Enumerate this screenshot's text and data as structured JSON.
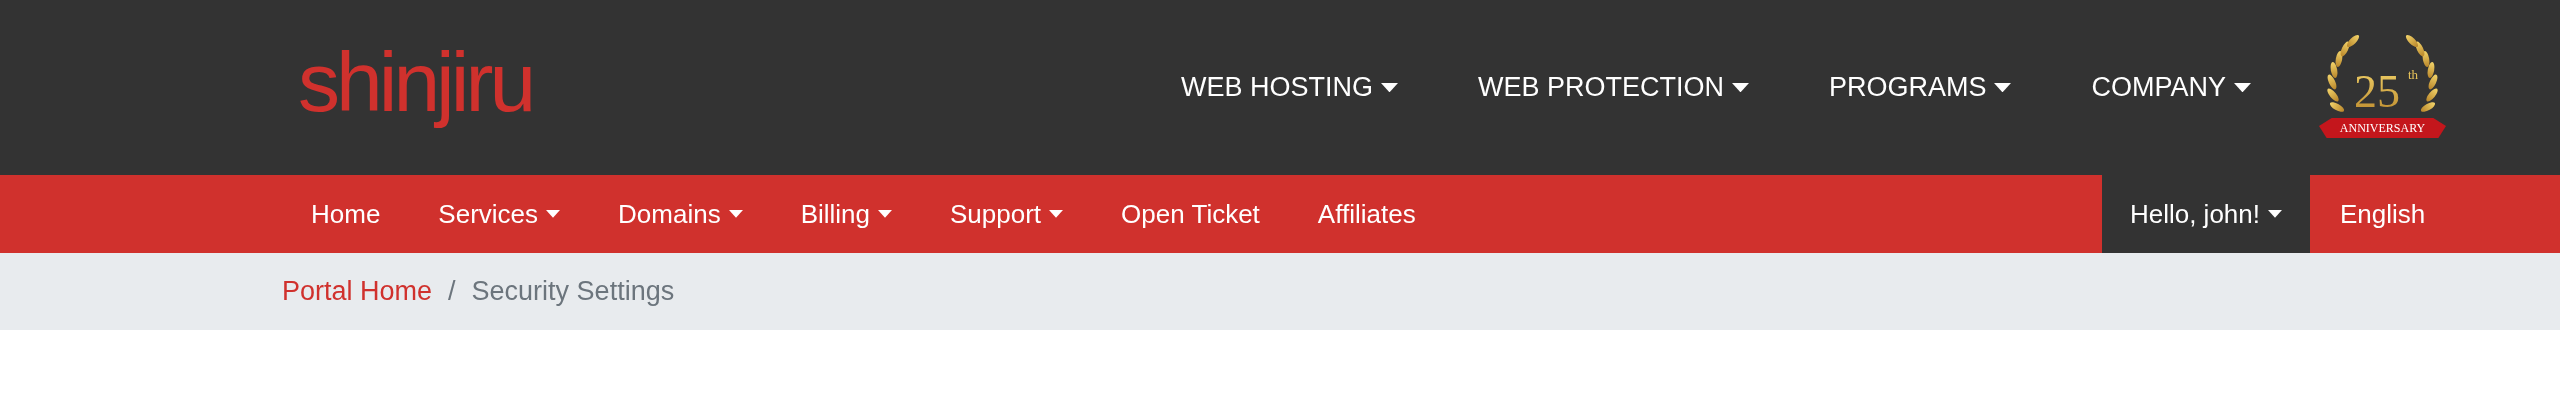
{
  "logo": {
    "text": "shinjiru"
  },
  "top_nav": [
    {
      "label": "WEB HOSTING",
      "dropdown": true
    },
    {
      "label": "WEB PROTECTION",
      "dropdown": true
    },
    {
      "label": "PROGRAMS",
      "dropdown": true
    },
    {
      "label": "COMPANY",
      "dropdown": true
    }
  ],
  "badge": {
    "number": "25",
    "suffix": "th",
    "ribbon": "ANNIVERSARY"
  },
  "main_nav": [
    {
      "label": "Home",
      "dropdown": false
    },
    {
      "label": "Services",
      "dropdown": true
    },
    {
      "label": "Domains",
      "dropdown": true
    },
    {
      "label": "Billing",
      "dropdown": true
    },
    {
      "label": "Support",
      "dropdown": true
    },
    {
      "label": "Open Ticket",
      "dropdown": false
    },
    {
      "label": "Affiliates",
      "dropdown": false
    }
  ],
  "account_menu": {
    "label": "Hello, john!",
    "dropdown": true
  },
  "language": {
    "label": "English"
  },
  "breadcrumb": [
    {
      "label": "Portal Home",
      "kind": "link"
    },
    {
      "label": "/",
      "kind": "separator"
    },
    {
      "label": "Security Settings",
      "kind": "current"
    }
  ]
}
